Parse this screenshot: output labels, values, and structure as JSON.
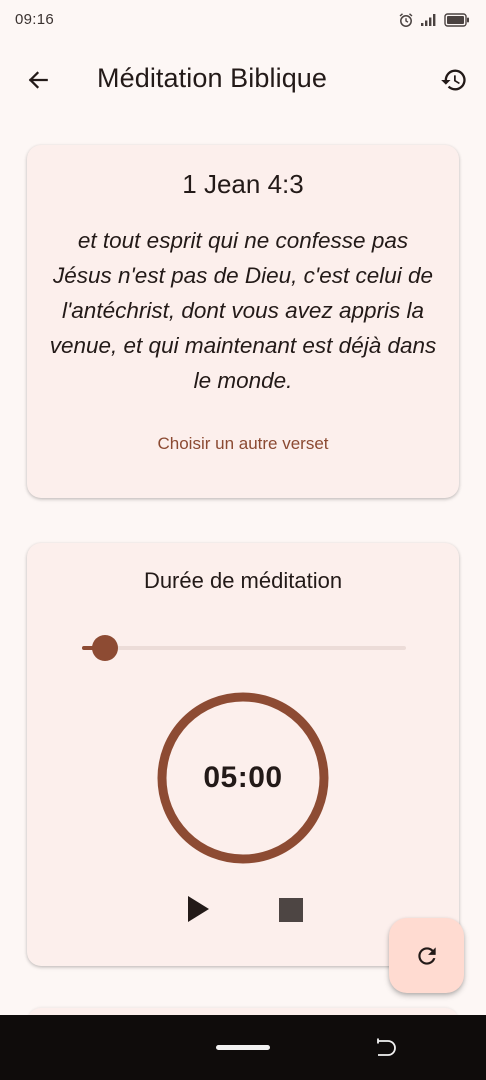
{
  "status_bar": {
    "time": "09:16",
    "icons": [
      "alarm-icon",
      "signal-icon",
      "battery-icon"
    ]
  },
  "app_bar": {
    "title": "Méditation Biblique",
    "back_icon": "arrow-left-icon",
    "history_icon": "history-icon"
  },
  "verse_card": {
    "reference": "1 Jean 4:3",
    "text": "et tout esprit qui ne confesse pas Jésus n'est pas de Dieu, c'est celui de l'antéchrist, dont vous avez appris la venue, et qui maintenant est déjà dans le monde.",
    "choose_label": "Choisir un autre verset"
  },
  "timer_card": {
    "duration_label": "Durée de méditation",
    "slider_fraction": 0.07,
    "time_display": "05:00",
    "play_icon": "play-icon",
    "stop_icon": "stop-icon"
  },
  "fab": {
    "icon": "refresh-icon"
  },
  "colors": {
    "background": "#fdf7f5",
    "card": "#fcefec",
    "accent": "#8d4b33",
    "link": "#8b4a32",
    "fab": "#ffdbd1",
    "text": "#231a18"
  }
}
